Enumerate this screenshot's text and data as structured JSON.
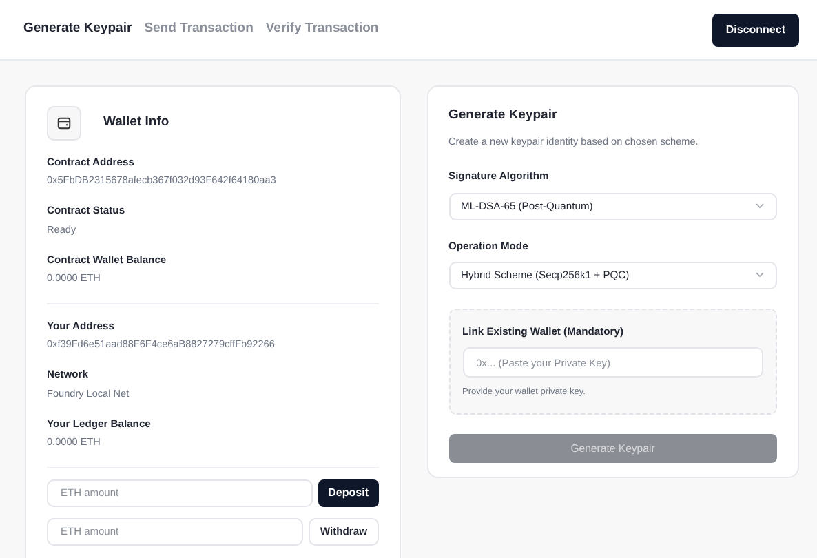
{
  "tabs": [
    {
      "label": "Generate Keypair",
      "selected": true
    },
    {
      "label": "Send Transaction",
      "selected": false
    },
    {
      "label": "Verify Transaction",
      "selected": false
    }
  ],
  "disconnect_button": "Disconnect",
  "wallet_info": {
    "title": "Wallet Info",
    "groups": [
      [
        {
          "label": "Contract Address",
          "value": "0x5FbDB2315678afecb367f032d93F642f64180aa3"
        },
        {
          "label": "Contract Status",
          "value": "Ready"
        },
        {
          "label": "Contract Wallet Balance",
          "value": "0.0000 ETH"
        }
      ],
      [
        {
          "label": "Your Address",
          "value": "0xf39Fd6e51aad88F6F4ce6aB8827279cffFb92266"
        },
        {
          "label": "Network",
          "value": "Foundry Local Net"
        },
        {
          "label": "Your Ledger Balance",
          "value": "0.0000 ETH"
        }
      ]
    ],
    "actions": [
      {
        "placeholder": "ETH amount",
        "button": "Deposit",
        "kind": "primary"
      },
      {
        "placeholder": "ETH amount",
        "button": "Withdraw",
        "kind": "outline"
      }
    ]
  },
  "generate": {
    "title": "Generate Keypair",
    "description": "Create a new keypair identity based on chosen scheme.",
    "selects": [
      {
        "label": "Signature Algorithm",
        "value": "ML-DSA-65 (Post-Quantum)"
      },
      {
        "label": "Operation Mode",
        "value": "Hybrid Scheme (Secp256k1 + PQC)"
      }
    ],
    "link_wallet": {
      "title": "Link Existing Wallet (Mandatory)",
      "placeholder": "0x... (Paste your Private Key)",
      "help": "Provide your wallet private key."
    },
    "submit": {
      "label": "Generate Keypair",
      "disabled": true
    }
  }
}
